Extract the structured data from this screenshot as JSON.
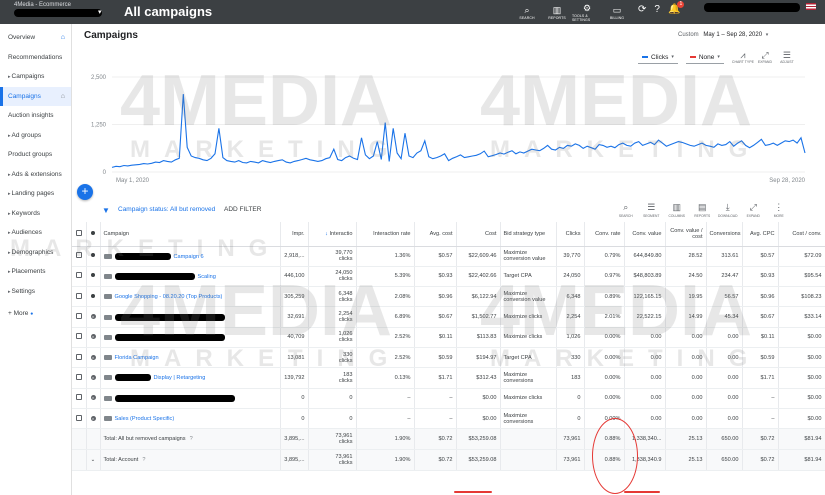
{
  "account": {
    "name": "4Media - Ecommerce"
  },
  "page": {
    "title": "All campaigns"
  },
  "topbar": {
    "actions": [
      {
        "icon": "search-icon",
        "label": "SEARCH",
        "glyph": "⌕"
      },
      {
        "icon": "reports-icon",
        "label": "REPORTS",
        "glyph": "▥"
      },
      {
        "icon": "tools-icon",
        "label": "TOOLS & SETTINGS",
        "glyph": "⚙"
      },
      {
        "icon": "billing-icon",
        "label": "BILLING",
        "glyph": "▭"
      }
    ],
    "notification_count": "1"
  },
  "sidebar": {
    "items": [
      {
        "label": "Overview",
        "expand": "",
        "home": true
      },
      {
        "label": "Recommendations",
        "expand": ""
      },
      {
        "label": "Campaigns",
        "expand": "▸"
      },
      {
        "label": "Campaigns",
        "expand": "",
        "active": true,
        "home": true
      },
      {
        "label": "Auction insights",
        "expand": ""
      },
      {
        "label": "Ad groups",
        "expand": "▸"
      },
      {
        "label": "Product groups",
        "expand": ""
      },
      {
        "label": "Ads & extensions",
        "expand": "▸"
      },
      {
        "label": "Landing pages",
        "expand": "▸"
      },
      {
        "label": "Keywords",
        "expand": "▸"
      },
      {
        "label": "Audiences",
        "expand": "▸"
      },
      {
        "label": "Demographics",
        "expand": "▸"
      },
      {
        "label": "Placements",
        "expand": "▸"
      },
      {
        "label": "Settings",
        "expand": "▸"
      }
    ],
    "more": "More"
  },
  "header": {
    "title": "Campaigns",
    "custom_label": "Custom",
    "date_range": "May 1 – Sep 28, 2020"
  },
  "chart_tools": {
    "metric1": "Clicks",
    "metric2": "None",
    "buttons": [
      {
        "icon": "chart-type-icon",
        "label": "CHART TYPE",
        "glyph": "⩘"
      },
      {
        "icon": "expand-icon",
        "label": "EXPAND",
        "glyph": "⤢"
      },
      {
        "icon": "adjust-icon",
        "label": "ADJUST",
        "glyph": "☰"
      }
    ]
  },
  "chart_data": {
    "type": "line",
    "series": [
      {
        "name": "Clicks",
        "color": "#1a73e8"
      }
    ],
    "x_start": "May 1, 2020",
    "x_end": "Sep 28, 2020",
    "yticks": [
      "2,500",
      "1,250",
      "0"
    ],
    "ylim": [
      0,
      2500
    ],
    "values": [
      120,
      150,
      140,
      170,
      160,
      180,
      190,
      200,
      220,
      210,
      230,
      260,
      250,
      300,
      280,
      260,
      320,
      360,
      2050,
      650,
      420,
      380,
      360,
      320,
      300,
      360,
      480,
      1150,
      380,
      300,
      280,
      260,
      300,
      250,
      240,
      280,
      260,
      240,
      300,
      270,
      250,
      280,
      300,
      320,
      260,
      240,
      280,
      300,
      330,
      360,
      320,
      300,
      280,
      300,
      350,
      380,
      600,
      330,
      300,
      380,
      420,
      360,
      330,
      900,
      450,
      350,
      420,
      800,
      330,
      1300,
      280,
      1150,
      500,
      350,
      1020,
      420,
      380,
      500,
      560,
      820,
      400,
      350,
      380,
      420,
      480,
      300,
      360,
      400,
      450,
      380,
      400,
      420,
      440,
      480,
      550,
      400,
      430,
      460,
      500,
      470,
      520,
      560,
      480,
      530,
      500,
      550,
      600,
      580,
      560,
      620,
      700,
      600,
      580,
      650,
      620,
      700,
      680,
      740,
      700,
      620,
      680,
      640,
      600,
      720,
      700,
      650,
      680,
      640,
      720,
      760,
      700,
      680,
      760,
      800,
      700,
      740,
      780,
      720,
      840,
      760,
      680,
      720,
      760,
      800,
      780,
      740,
      700,
      680,
      720,
      760,
      700,
      680,
      650,
      740,
      700,
      720,
      800,
      680,
      760,
      820,
      700,
      640,
      700,
      780,
      860,
      700,
      720,
      760,
      700,
      760,
      820,
      800,
      840,
      760,
      900,
      500
    ],
    "grid": true
  },
  "filter": {
    "status_label": "Campaign status:",
    "status_value": "All but removed",
    "add_filter": "ADD FILTER"
  },
  "table_tools": [
    {
      "icon": "search-icon",
      "label": "SEARCH",
      "glyph": "⌕"
    },
    {
      "icon": "segment-icon",
      "label": "SEGMENT",
      "glyph": "☰"
    },
    {
      "icon": "columns-icon",
      "label": "COLUMNS",
      "glyph": "▥"
    },
    {
      "icon": "reports-icon",
      "label": "REPORTS",
      "glyph": "▤"
    },
    {
      "icon": "download-icon",
      "label": "DOWNLOAD",
      "glyph": "⤓"
    },
    {
      "icon": "expand-icon",
      "label": "EXPAND",
      "glyph": "⤢"
    },
    {
      "icon": "more-icon",
      "label": "MORE",
      "glyph": "⋮"
    }
  ],
  "table": {
    "headers": [
      "Campaign",
      "Impr.",
      "Interactio",
      "Interaction rate",
      "Avg. cost",
      "Cost",
      "Bid strategy type",
      "Clicks",
      "Conv. rate",
      "Conv. value",
      "Conv. value / cost",
      "Conversions",
      "Avg. CPC",
      "Cost / conv."
    ],
    "rows": [
      {
        "status": "enabled",
        "name": "Campaign 6",
        "redact": 56,
        "impr": "2,918,...",
        "inter": "39,770",
        "inter_sub": "clicks",
        "rate": "1.36%",
        "avg": "$0.57",
        "cost": "$22,609.46",
        "bid": "Maximize conversion value",
        "bid_link": true,
        "clicks": "39,770",
        "crate": "0.79%",
        "cval": "644,849.80",
        "cvc": "28.52",
        "conv": "313.61",
        "cpc": "$0.57",
        "cpconv": "$72.09"
      },
      {
        "status": "enabled",
        "name": "Scaling",
        "redact": 80,
        "impr": "446,100",
        "inter": "24,050",
        "inter_sub": "clicks",
        "rate": "5.39%",
        "avg": "$0.93",
        "cost": "$22,402.66",
        "bid": "Target CPA",
        "bid_link": true,
        "clicks": "24,050",
        "crate": "0.97%",
        "cval": "$48,803.89",
        "cvc": "24.50",
        "conv": "234.47",
        "cpc": "$0.93",
        "cpconv": "$95.54"
      },
      {
        "status": "enabled",
        "name": "Google Shopping - 08.20.20 (Top Products)",
        "redact": 0,
        "impr": "305,259",
        "inter": "6,348",
        "inter_sub": "clicks",
        "rate": "2.08%",
        "avg": "$0.96",
        "cost": "$6,122.94",
        "bid": "Maximize conversion value",
        "bid_link": true,
        "clicks": "6,348",
        "crate": "0.89%",
        "cval": "122,165.15",
        "cvc": "19.95",
        "conv": "56.57",
        "cpc": "$0.96",
        "cpconv": "$108.23"
      },
      {
        "status": "removed",
        "name": "",
        "redact": 110,
        "impr": "32,691",
        "inter": "2,254",
        "inter_sub": "clicks",
        "rate": "6.89%",
        "avg": "$0.67",
        "cost": "$1,502.77",
        "bid": "Maximize clicks",
        "bid_link": true,
        "clicks": "2,254",
        "crate": "2.01%",
        "cval": "22,522.15",
        "cvc": "14.99",
        "conv": "45.34",
        "cpc": "$0.67",
        "cpconv": "$33.14"
      },
      {
        "status": "removed",
        "name": "",
        "redact": 110,
        "impr": "40,709",
        "inter": "1,026",
        "inter_sub": "clicks",
        "rate": "2.52%",
        "avg": "$0.11",
        "cost": "$113.83",
        "bid": "Maximize clicks",
        "bid_link": true,
        "clicks": "1,026",
        "crate": "0.00%",
        "cval": "0.00",
        "cvc": "0.00",
        "conv": "0.00",
        "cpc": "$0.11",
        "cpconv": "$0.00"
      },
      {
        "status": "removed",
        "name": "Florida Campaign",
        "redact": 0,
        "impr": "13,081",
        "inter": "330",
        "inter_sub": "clicks",
        "rate": "2.52%",
        "avg": "$0.59",
        "cost": "$194.97",
        "bid": "Target CPA",
        "bid_link": true,
        "clicks": "330",
        "crate": "0.00%",
        "cval": "0.00",
        "cvc": "0.00",
        "conv": "0.00",
        "cpc": "$0.59",
        "cpconv": "$0.00"
      },
      {
        "status": "removed",
        "name": "Display | Retargeting",
        "redact": 36,
        "impr": "139,792",
        "inter": "183",
        "inter_sub": "clicks",
        "rate": "0.13%",
        "avg": "$1.71",
        "cost": "$312.43",
        "bid": "Maximize conversions",
        "bid_link": true,
        "clicks": "183",
        "crate": "0.00%",
        "cval": "0.00",
        "cvc": "0.00",
        "conv": "0.00",
        "cpc": "$1.71",
        "cpconv": "$0.00"
      },
      {
        "status": "removed",
        "name": "",
        "redact": 120,
        "impr": "0",
        "inter": "0",
        "inter_sub": "",
        "rate": "–",
        "avg": "–",
        "cost": "$0.00",
        "bid": "Maximize clicks",
        "bid_link": true,
        "clicks": "0",
        "crate": "0.00%",
        "cval": "0.00",
        "cvc": "0.00",
        "conv": "0.00",
        "cpc": "–",
        "cpconv": "$0.00"
      },
      {
        "status": "removed",
        "name": "Sales (Product Specific)",
        "redact": 0,
        "impr": "0",
        "inter": "0",
        "inter_sub": "",
        "rate": "–",
        "avg": "–",
        "cost": "$0.00",
        "bid": "Maximize conversions",
        "bid_link": true,
        "clicks": "0",
        "crate": "0.00%",
        "cval": "0.00",
        "cvc": "0.00",
        "conv": "0.00",
        "cpc": "–",
        "cpconv": "$0.00"
      }
    ],
    "totals": [
      {
        "label": "Total: All but removed campaigns",
        "impr": "3,895,...",
        "inter": "73,961",
        "inter_sub": "clicks",
        "rate": "1.90%",
        "avg": "$0.72",
        "cost": "$53,259.08",
        "bid": "",
        "clicks": "73,961",
        "crate": "0.88%",
        "cval": "1,338,340...",
        "cvc": "25.13",
        "conv": "650.00",
        "cpc": "$0.72",
        "cpconv": "$81.94"
      },
      {
        "label": "Total: Account",
        "impr": "3,895,...",
        "inter": "73,961",
        "inter_sub": "clicks",
        "rate": "1.90%",
        "avg": "$0.72",
        "cost": "$53,259.08",
        "bid": "",
        "clicks": "73,961",
        "crate": "0.88%",
        "cval": "1,338,340.9",
        "cvc": "25.13",
        "conv": "650.00",
        "cpc": "$0.72",
        "cpconv": "$81.94"
      }
    ]
  },
  "watermark": {
    "brand": "4MEDIA",
    "tagline": "MARKETING"
  }
}
